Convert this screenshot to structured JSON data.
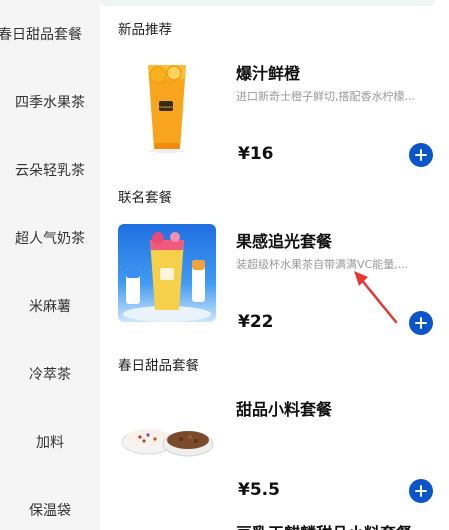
{
  "sidebar": {
    "items": [
      {
        "label": "春日甜品套餐"
      },
      {
        "label": "四季水果茶"
      },
      {
        "label": "云朵轻乳茶"
      },
      {
        "label": "超人气奶茶"
      },
      {
        "label": "米麻薯"
      },
      {
        "label": "冷萃茶"
      },
      {
        "label": "加料"
      },
      {
        "label": "保温袋"
      }
    ]
  },
  "sections": [
    {
      "title": "新品推荐"
    },
    {
      "title": "联名套餐"
    },
    {
      "title": "春日甜品套餐"
    }
  ],
  "products": [
    {
      "name": "爆汁鲜橙",
      "desc": "进口新奇士橙子鲜切,搭配香水柠檬...",
      "price": "¥16"
    },
    {
      "name": "果感追光套餐",
      "desc": "装超级杯水果茶自带满满VC能量,...",
      "price": "¥22"
    },
    {
      "name": "甜品小料套餐",
      "desc": "",
      "price": "¥5.5"
    },
    {
      "name": "豆乳玉麒麟甜品小料套餐",
      "desc": "",
      "price": ""
    }
  ],
  "colors": {
    "accent": "#0a55c9",
    "annotation_arrow": "#e53935"
  }
}
